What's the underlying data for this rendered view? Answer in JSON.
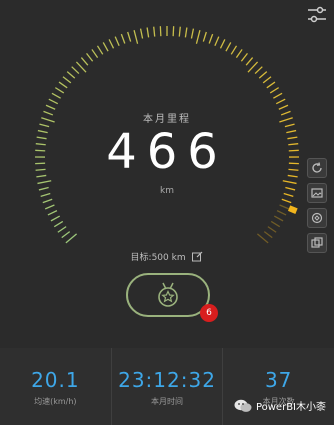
{
  "gauge": {
    "label": "本月里程",
    "value": "466",
    "unit": "km",
    "goal_text": "目标:500 km",
    "progress_fraction": 0.932
  },
  "medal": {
    "badge_count": "6"
  },
  "stats": [
    {
      "value": "20.1",
      "label": "均速(km/h)"
    },
    {
      "value": "23:12:32",
      "label": "本月时间"
    },
    {
      "value": "37",
      "label": "本月次数"
    }
  ],
  "watermark": {
    "text": "PowerBI木小桼"
  },
  "icons": {
    "settings": "settings-sliders-icon",
    "side_tools": [
      "refresh-icon",
      "image-icon",
      "tag-icon",
      "copy-icon"
    ]
  },
  "colors": {
    "gauge_start": "#9cc77b",
    "gauge_end": "#f2b51d",
    "accent_blue": "#3ea7e8",
    "badge_red": "#d81e1e",
    "medal_outline": "#9ab27d"
  }
}
